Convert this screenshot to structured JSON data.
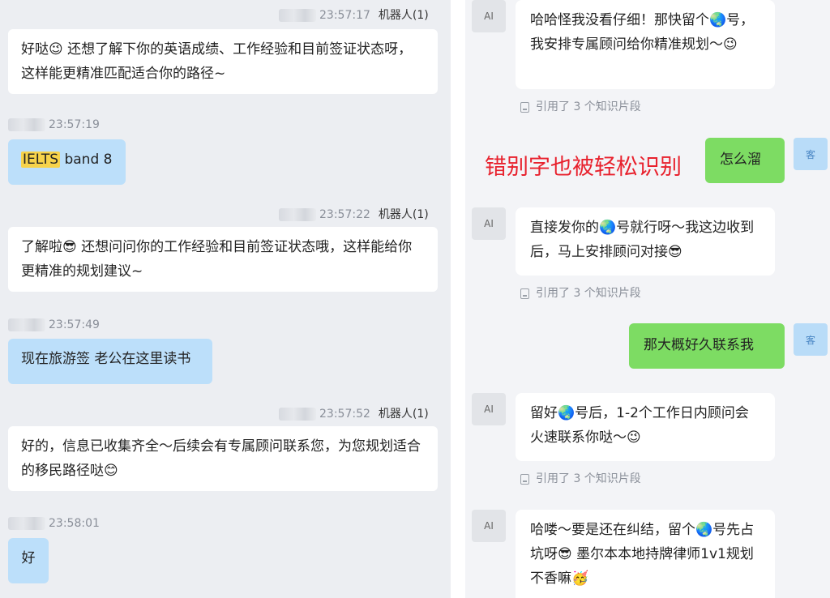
{
  "left": {
    "bot_sender": "机器人(1)",
    "messages": [
      {
        "time": "23:57:17",
        "text": "好哒😉 还想了解下你的英语成绩、工作经验和目前签证状态呀，这样能更精准匹配适合你的路径~"
      },
      {
        "time": "23:57:19",
        "highlight": "IELTS",
        "text": " band 8"
      },
      {
        "time": "23:57:22",
        "text": "了解啦😎 还想问问你的工作经验和目前签证状态哦，这样能给你更精准的规划建议~"
      },
      {
        "time": "23:57:49",
        "text": "现在旅游签 老公在这里读书"
      },
      {
        "time": "23:57:52",
        "text": "好的，信息已收集齐全～后续会有专属顾问联系您，为您规划适合的移民路径哒😊"
      },
      {
        "time": "23:58:01",
        "text": "好"
      }
    ]
  },
  "right": {
    "ai_avatar_label": "AI",
    "customer_avatar_label": "客",
    "citation_text": "引用了 3 个知识片段",
    "annotation": "错别字也被轻松识别",
    "messages": [
      {
        "text": "哈哈怪我没看仔细！那快留个🌏号，我安排专属顾问给你精准规划～😉"
      },
      {
        "text": "怎么溜"
      },
      {
        "text": "直接发你的🌏号就行呀～我这边收到后，马上安排顾问对接😎"
      },
      {
        "text": "那大概好久联系我"
      },
      {
        "text": "留好🌏号后，1-2个工作日内顾问会火速联系你哒～😉"
      },
      {
        "text": "哈喽～要是还在纠结，留个🌏号先占坑呀😎 墨尔本本地持牌律师1v1规划不香嘛🥳"
      }
    ]
  }
}
